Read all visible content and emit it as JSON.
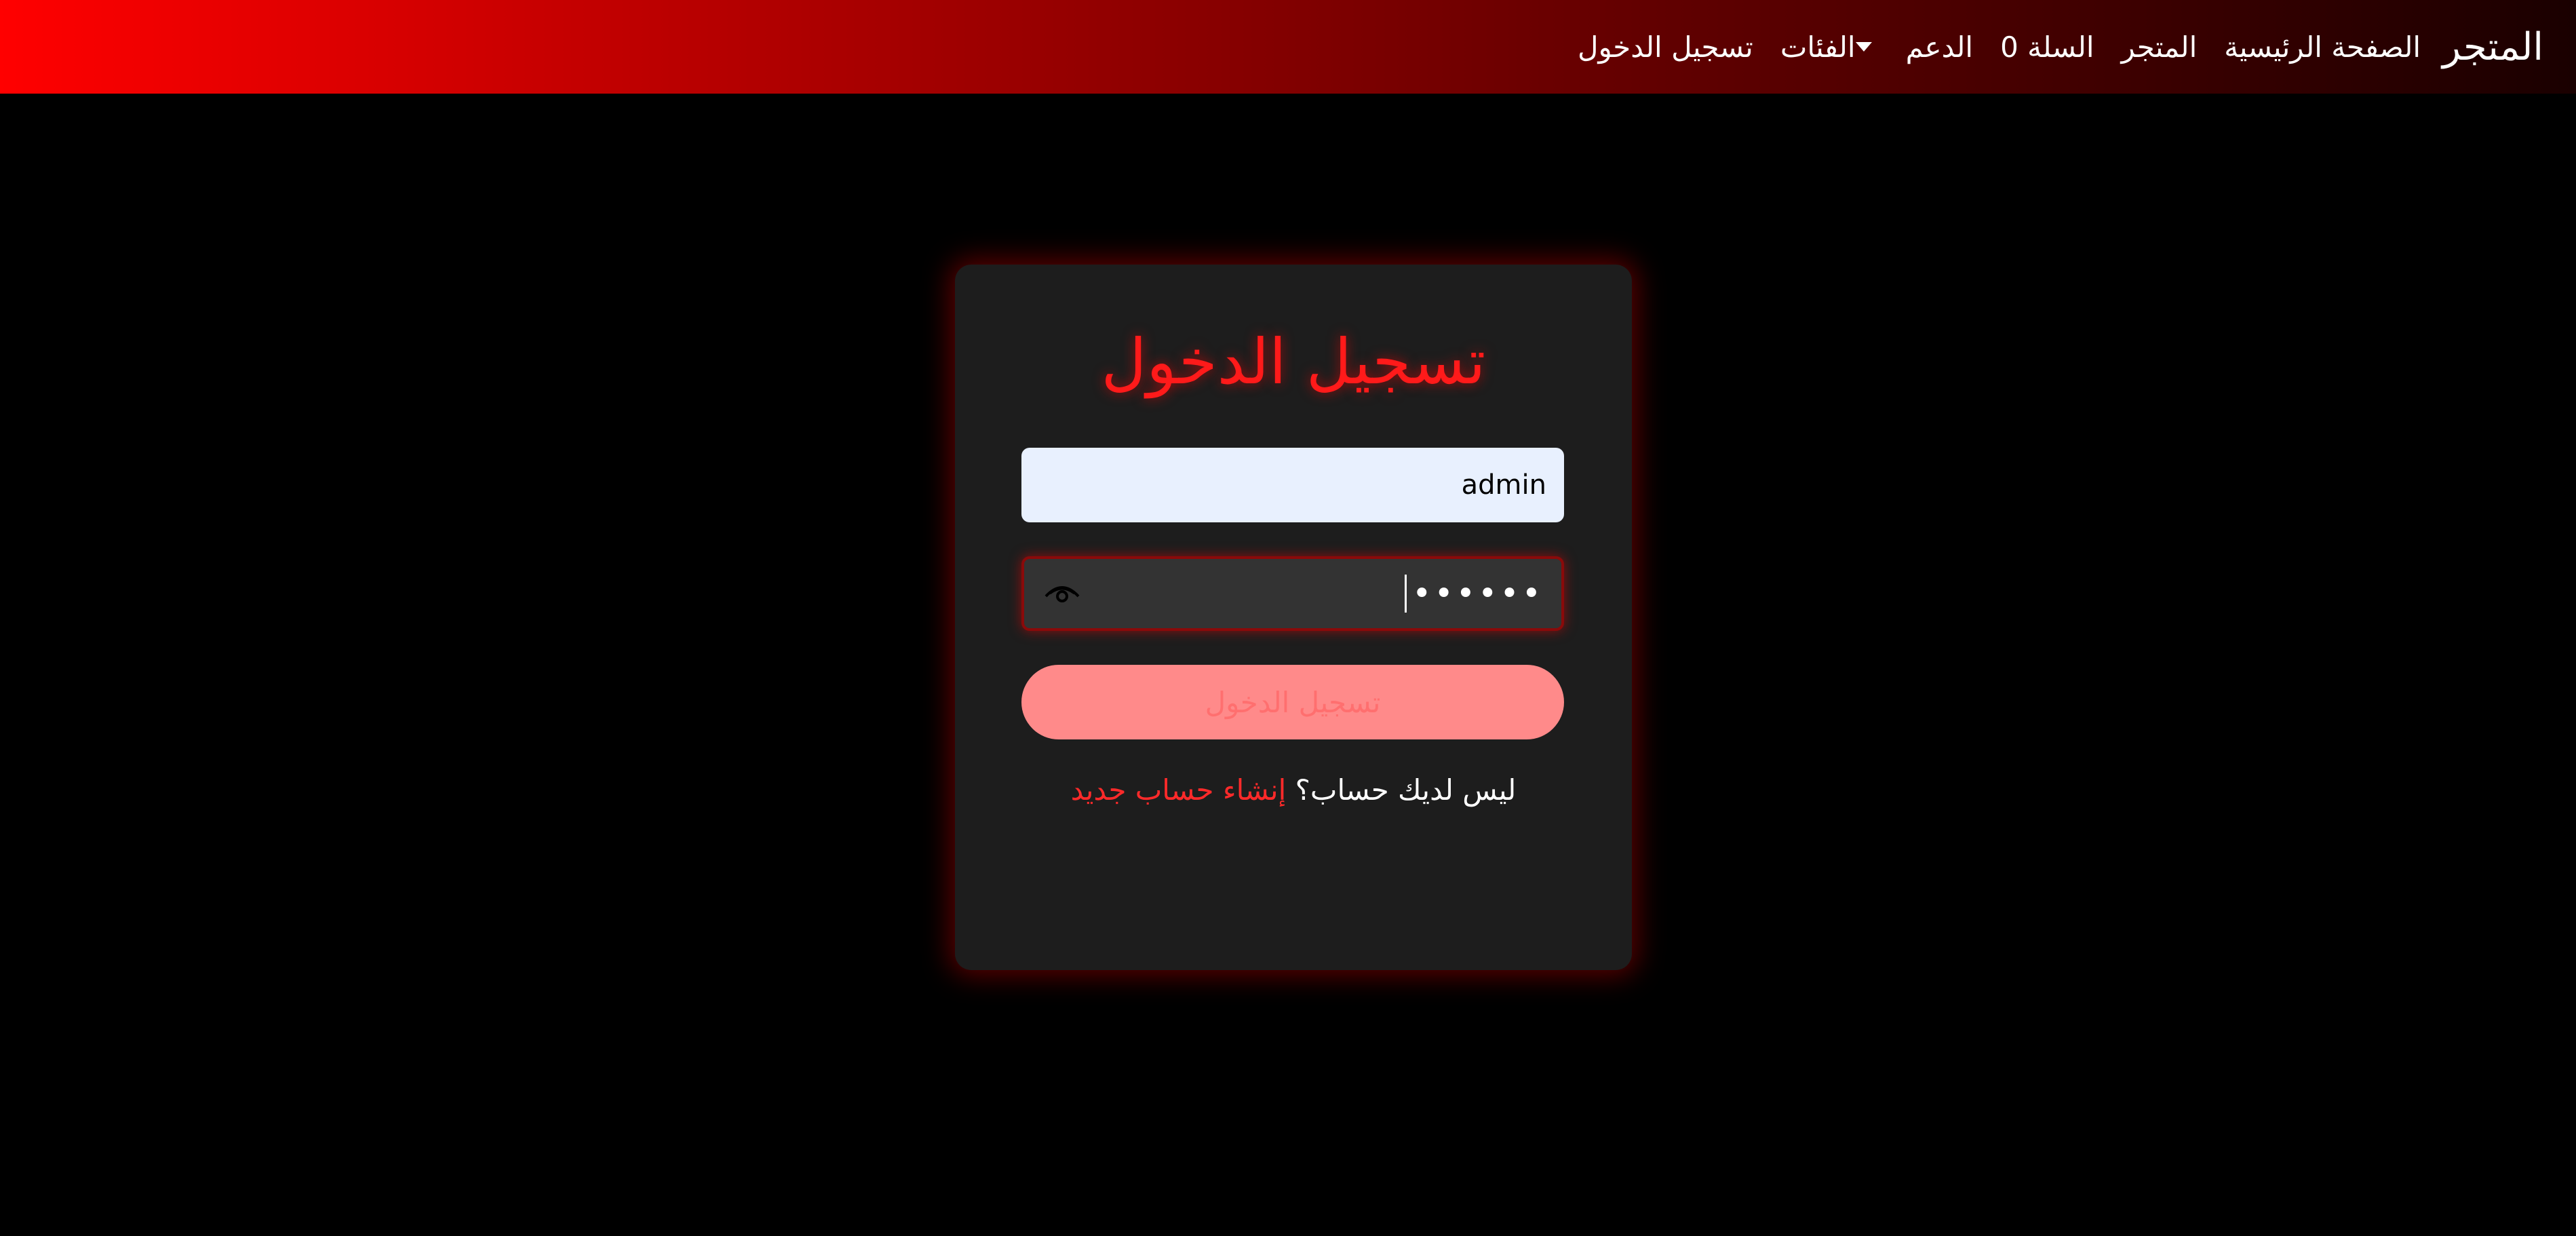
{
  "navbar": {
    "brand": "المتجر",
    "items": [
      {
        "label": "الصفحة الرئيسية"
      },
      {
        "label": "المتجر"
      },
      {
        "label": "السلة 0"
      },
      {
        "label": "الدعم"
      },
      {
        "label": "الفئات"
      },
      {
        "label": "تسجيل الدخول"
      }
    ]
  },
  "login": {
    "title": "تسجيل الدخول",
    "username_value": "admin",
    "password_masked": "••••••",
    "submit_label": "تسجيل الدخول",
    "no_account_text": "ليس لديك حساب؟",
    "signup_link": "إنشاء حساب جديد"
  },
  "colors": {
    "accent": "#ff1a1a",
    "card_bg": "#1d1d1d",
    "button_bg": "#ff8a8a",
    "input_light_bg": "#e8f0fe",
    "input_dark_bg": "#333333"
  },
  "icons": {
    "password_toggle": "eye-icon",
    "categories_dropdown": "caret-down-icon"
  }
}
